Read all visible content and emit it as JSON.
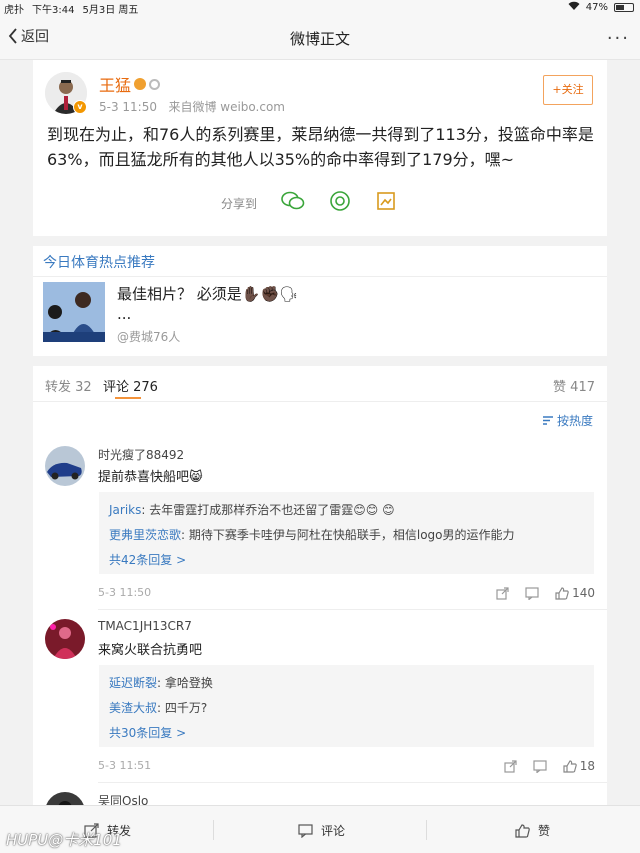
{
  "status_bar": {
    "carrier": "虎扑",
    "time": "下午3:44",
    "date": "5月3日 周五",
    "battery": "47%",
    "battery_level": 0.47
  },
  "nav": {
    "back_label": "返回",
    "title": "微博正文",
    "more": "···"
  },
  "post": {
    "author": "王猛",
    "time": "5-3 11:50",
    "source": "来自微博 weibo.com",
    "follow_label": "+关注",
    "text": "到现在为止，和76人的系列赛里，莱昂纳德一共得到了113分，投篮命中率是63%，而且猛龙所有的其他人以35%的命中率得到了179分，嘿~",
    "share_label": "分享到"
  },
  "hot": {
    "section_title": "今日体育热点推荐",
    "text_line1": "最佳相片？ 必须是✋🏿✊🏿🗣",
    "text_line2": "...",
    "source": "@费城76人"
  },
  "tabs": {
    "repost": "转发 32",
    "comment": "评论 276",
    "like": "赞 417",
    "sort": "按热度"
  },
  "comments": [
    {
      "name": "时光瘦了88492",
      "text": "提前恭喜快船吧😸",
      "replies": [
        {
          "who": "Jariks",
          "text": ": 去年雷霆打成那样乔治不也还留了雷霆😊😊 😊"
        },
        {
          "who": "更弗里茨恋歌",
          "text": ": 期待下赛季卡哇伊与阿杜在快船联手，相信logo男的运作能力"
        }
      ],
      "more": "共42条回复 >",
      "time": "5-3 11:50",
      "likes": "140"
    },
    {
      "name": "TMAC1JH13CR7",
      "text": "来窝火联合抗勇吧",
      "replies": [
        {
          "who": "延迟断裂",
          "text": ": 拿哈登换"
        },
        {
          "who": "美渣大叔",
          "text": ": 四千万?"
        }
      ],
      "more": "共30条回复 >",
      "time": "5-3 11:51",
      "likes": "18"
    },
    {
      "name": "吴同Oslo"
    }
  ],
  "bottom_bar": {
    "repost": "转发",
    "comment": "评论",
    "like": "赞"
  },
  "watermark": "HUPU@卡米101"
}
